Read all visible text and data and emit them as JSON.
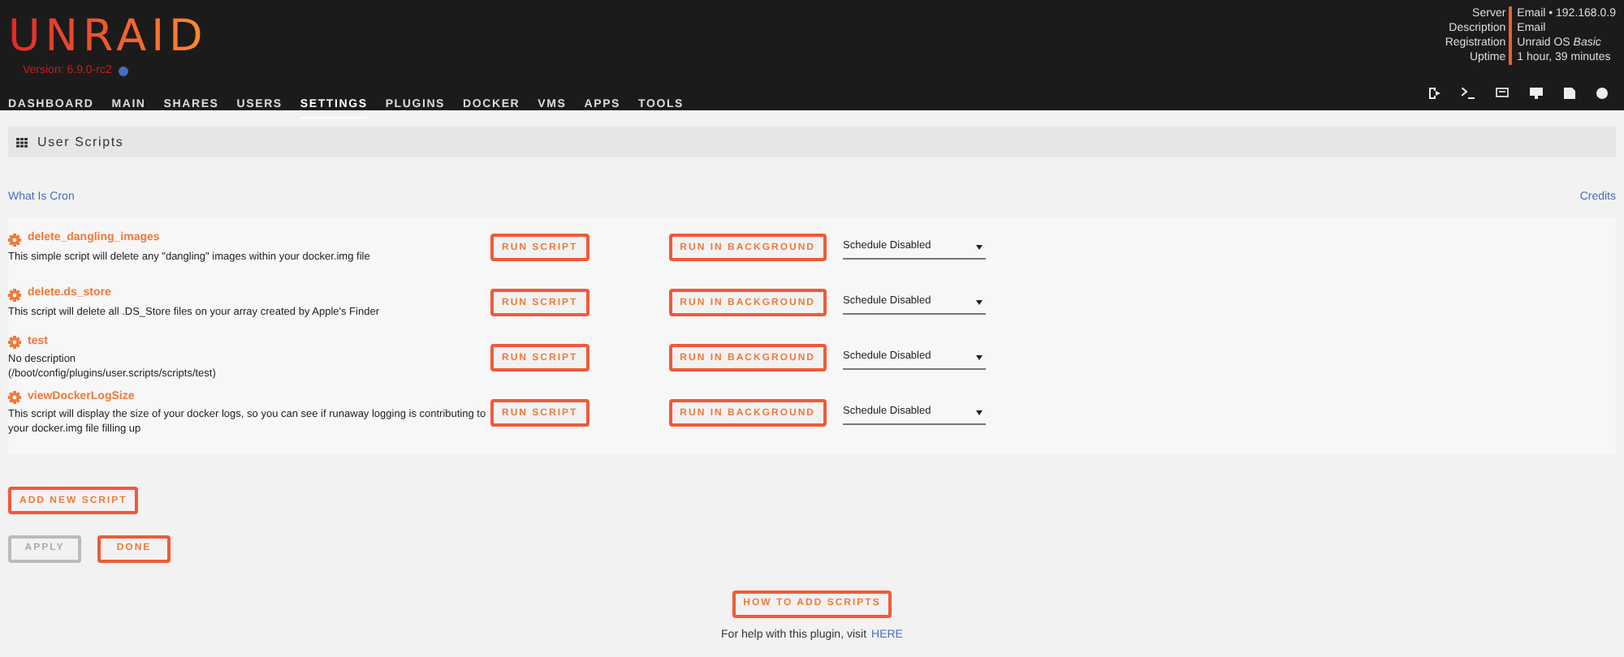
{
  "header": {
    "logo": "UNRAID",
    "version": "Version: 6.9.0-rc2",
    "info": [
      {
        "label": "Server",
        "value": "Email • 192.168.0.9"
      },
      {
        "label": "Description",
        "value": "Email"
      },
      {
        "label": "Registration",
        "value": "Unraid OS *Basic*"
      },
      {
        "label": "Uptime",
        "value": "1 hour, 39 minutes"
      }
    ]
  },
  "nav": [
    {
      "label": "DASHBOARD",
      "selected": false
    },
    {
      "label": "MAIN",
      "selected": false
    },
    {
      "label": "SHARES",
      "selected": false
    },
    {
      "label": "USERS",
      "selected": false
    },
    {
      "label": "SETTINGS",
      "selected": true
    },
    {
      "label": "PLUGINS",
      "selected": false
    },
    {
      "label": "DOCKER",
      "selected": false
    },
    {
      "label": "VMS",
      "selected": false
    },
    {
      "label": "APPS",
      "selected": false
    },
    {
      "label": "TOOLS",
      "selected": false
    }
  ],
  "page_title": "User Scripts",
  "links": {
    "left": "What Is Cron",
    "right": "Credits"
  },
  "scripts": [
    {
      "name": "delete_dangling_images",
      "description": "This simple script will delete any \"dangling\" images within your docker.img file",
      "run": "RUN SCRIPT",
      "background": "RUN IN BACKGROUND",
      "schedule": "Schedule Disabled"
    },
    {
      "name": "delete.ds_store",
      "description": "This script will delete all .DS_Store files on your array created by Apple's Finder",
      "run": "RUN SCRIPT",
      "background": "RUN IN BACKGROUND",
      "schedule": "Schedule Disabled"
    },
    {
      "name": "test",
      "description": "No description\n(/boot/config/plugins/user.scripts/scripts/test)",
      "run": "RUN SCRIPT",
      "background": "RUN IN BACKGROUND",
      "schedule": "Schedule Disabled"
    },
    {
      "name": "viewDockerLogSize",
      "description": "This script will display the size of your docker logs, so you can see if runaway logging is contributing to your docker.img file filling up",
      "run": "RUN SCRIPT",
      "background": "RUN IN BACKGROUND",
      "schedule": "Schedule Disabled"
    }
  ],
  "add_button": "ADD NEW SCRIPT",
  "form_buttons": [
    {
      "label": "APPLY",
      "disabled": true
    },
    {
      "label": "DONE",
      "disabled": false
    }
  ],
  "how_button": "HOW TO ADD SCRIPTS",
  "help": {
    "text": "For help with this plugin, visit",
    "link": "HERE"
  }
}
